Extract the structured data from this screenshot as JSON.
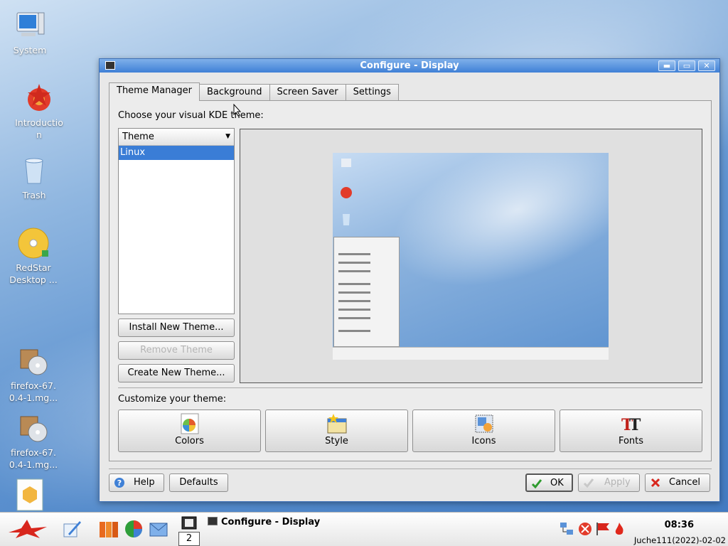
{
  "desktop": {
    "icons": [
      {
        "label": "System"
      },
      {
        "label": "Introduction"
      },
      {
        "label": "Trash"
      },
      {
        "label": "RedStar Desktop ..."
      },
      {
        "label": "firefox-67.0.4-1.mg..."
      },
      {
        "label": "firefox-67.0.4-1.mg..."
      }
    ]
  },
  "window": {
    "title": "Configure - Display",
    "controls": {
      "minimize": "▬",
      "maximize": "▭",
      "close": "✕"
    },
    "tabs": [
      {
        "label": "Theme Manager"
      },
      {
        "label": "Background"
      },
      {
        "label": "Screen Saver"
      },
      {
        "label": "Settings"
      }
    ],
    "choose_label": "Choose your visual KDE theme:",
    "list": {
      "header": "Theme",
      "items": [
        "Linux"
      ]
    },
    "buttons": {
      "install": "Install New Theme...",
      "remove": "Remove Theme",
      "create": "Create New Theme..."
    },
    "customize_label": "Customize your theme:",
    "customize": [
      {
        "label": "Colors",
        "icon": "colors-icon"
      },
      {
        "label": "Style",
        "icon": "style-icon"
      },
      {
        "label": "Icons",
        "icon": "icons-icon"
      },
      {
        "label": "Fonts",
        "icon": "fonts-icon"
      }
    ],
    "footer": {
      "help": "Help",
      "defaults": "Defaults",
      "ok": "OK",
      "apply": "Apply",
      "cancel": "Cancel"
    }
  },
  "taskbar": {
    "pager": "2",
    "task_title": "Configure - Display",
    "clock": "08:36",
    "date": "Juche111(2022)-02-02"
  },
  "colors": {
    "accent": "#3a7dd6",
    "titlebar": "#3f80d6"
  }
}
